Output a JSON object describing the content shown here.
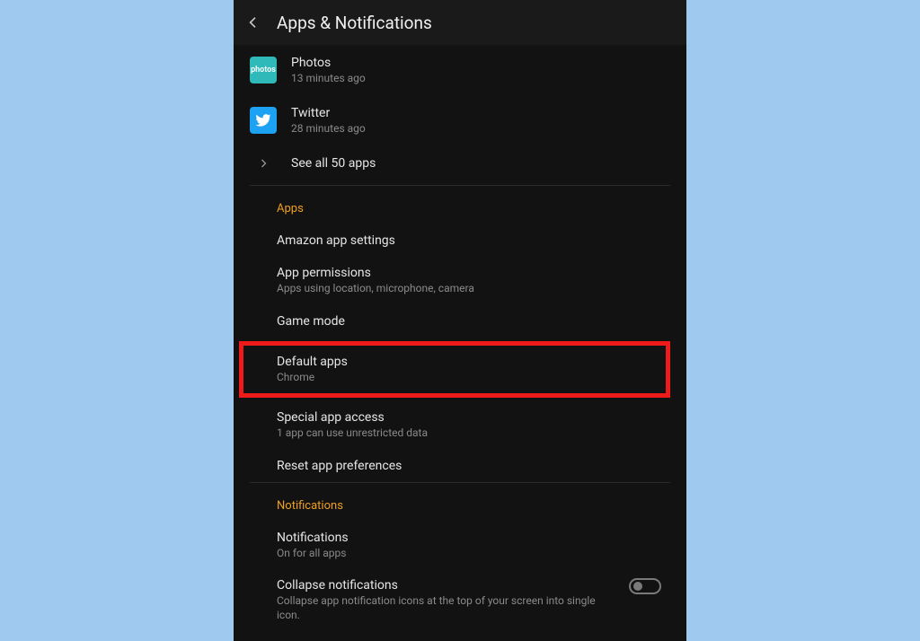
{
  "header": {
    "title": "Apps & Notifications"
  },
  "recent_apps": [
    {
      "name": "Photos",
      "sub": "13 minutes ago",
      "icon": "photos"
    },
    {
      "name": "Twitter",
      "sub": "28 minutes ago",
      "icon": "twitter"
    }
  ],
  "see_all": "See all 50 apps",
  "sections": {
    "apps": {
      "header": "Apps",
      "items": {
        "amazon": {
          "title": "Amazon app settings"
        },
        "perms": {
          "title": "App permissions",
          "sub": "Apps using location, microphone, camera"
        },
        "game": {
          "title": "Game mode"
        },
        "default": {
          "title": "Default apps",
          "sub": "Chrome"
        },
        "special": {
          "title": "Special app access",
          "sub": "1 app can use unrestricted data"
        },
        "reset": {
          "title": "Reset app preferences"
        }
      }
    },
    "notifications": {
      "header": "Notifications",
      "items": {
        "notif": {
          "title": "Notifications",
          "sub": "On for all apps"
        },
        "collapse": {
          "title": "Collapse notifications",
          "sub": "Collapse app notification icons at the top of your screen into single icon."
        }
      }
    }
  },
  "toggles": {
    "collapse": false
  }
}
